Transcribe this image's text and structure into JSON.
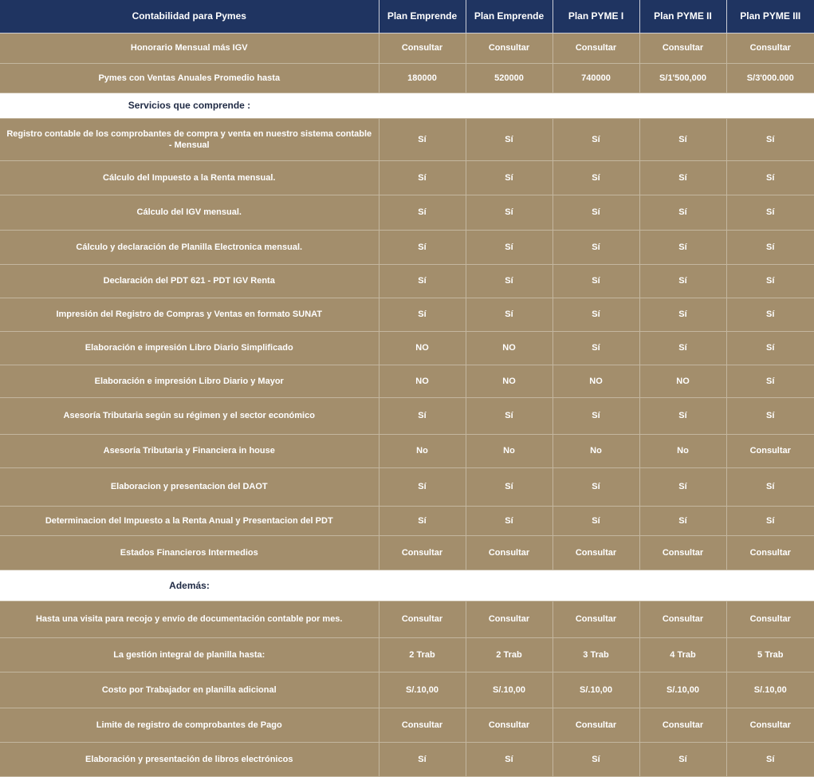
{
  "table": {
    "header": {
      "label": "Contabilidad para Pymes",
      "plans": [
        "Plan Emprende",
        "Plan Emprende",
        "Plan PYME I",
        "Plan PYME II",
        "Plan PYME III"
      ]
    },
    "colors": {
      "header_bg": "#1f3461",
      "row_bg": "#a38e6c",
      "section_bg": "#ffffff"
    },
    "sections": [
      {
        "title": "",
        "rows": [
          {
            "label": "Honorario Mensual más IGV",
            "values": [
              "Consultar",
              "Consultar",
              "Consultar",
              "Consultar",
              "Consultar"
            ]
          },
          {
            "label": "Pymes con Ventas Anuales Promedio hasta",
            "values": [
              "180000",
              "520000",
              "740000",
              "S/1'500,000",
              "S/3'000.000"
            ]
          }
        ]
      },
      {
        "title": "Servicios que comprende :",
        "rows": [
          {
            "label": "Registro contable de los comprobantes de compra y venta en nuestro sistema contable - Mensual",
            "values": [
              "Sí",
              "Sí",
              "Sí",
              "Sí",
              "Sí"
            ]
          },
          {
            "label": "Cálculo del Impuesto a la Renta mensual.",
            "values": [
              "Sí",
              "Sí",
              "Sí",
              "Sí",
              "Sí"
            ]
          },
          {
            "label": "Cálculo del IGV mensual.",
            "values": [
              "Sí",
              "Sí",
              "Sí",
              "Sí",
              "Sí"
            ]
          },
          {
            "label": "Cálculo y declaración de Planilla Electronica mensual.",
            "values": [
              "Sí",
              "Sí",
              "Sí",
              "Sí",
              "Sí"
            ]
          },
          {
            "label": "Declaración del PDT 621 - PDT IGV Renta",
            "values": [
              "Sí",
              "Sí",
              "Sí",
              "Sí",
              "Sí"
            ]
          },
          {
            "label": "Impresión del Registro de Compras y Ventas en formato SUNAT",
            "values": [
              "Sí",
              "Sí",
              "Sí",
              "Sí",
              "Sí"
            ]
          },
          {
            "label": "Elaboración e impresión Libro Diario Simplificado",
            "values": [
              "NO",
              "NO",
              "Sí",
              "Sí",
              "Sí"
            ]
          },
          {
            "label": "Elaboración e impresión Libro Diario y Mayor",
            "values": [
              "NO",
              "NO",
              "NO",
              "NO",
              "Sí"
            ]
          },
          {
            "label": "Asesoría Tributaria según su régimen y el sector económico",
            "values": [
              "Sí",
              "Sí",
              "Sí",
              "Sí",
              "Sí"
            ]
          },
          {
            "label": "Asesoría Tributaria y Financiera in house",
            "values": [
              "No",
              "No",
              "No",
              "No",
              "Consultar"
            ]
          },
          {
            "label": "Elaboracion y presentacion del DAOT",
            "values": [
              "Sí",
              "Sí",
              "Sí",
              "Sí",
              "Sí"
            ]
          },
          {
            "label": "Determinacion del Impuesto a la Renta Anual y Presentacion del PDT",
            "values": [
              "Sí",
              "Sí",
              "Sí",
              "Sí",
              "Sí"
            ]
          },
          {
            "label": "Estados Financieros Intermedios",
            "values": [
              "Consultar",
              "Consultar",
              "Consultar",
              "Consultar",
              "Consultar"
            ]
          }
        ]
      },
      {
        "title": "Además:",
        "rows": [
          {
            "label": "Hasta una visita para recojo y envío de documentación contable por mes.",
            "values": [
              "Consultar",
              "Consultar",
              "Consultar",
              "Consultar",
              "Consultar"
            ]
          },
          {
            "label": "La gestión integral de planilla hasta:",
            "values": [
              "2 Trab",
              "2 Trab",
              "3 Trab",
              "4 Trab",
              "5 Trab"
            ]
          },
          {
            "label": "Costo por Trabajador en planilla adicional",
            "values": [
              "S/.10,00",
              "S/.10,00",
              "S/.10,00",
              "S/.10,00",
              "S/.10,00"
            ]
          },
          {
            "label": "Limite de registro de comprobantes de Pago",
            "values": [
              "Consultar",
              "Consultar",
              "Consultar",
              "Consultar",
              "Consultar"
            ]
          },
          {
            "label": "Elaboración y presentación de libros electrónicos",
            "values": [
              "Sí",
              "Sí",
              "Sí",
              "Sí",
              "Sí"
            ]
          }
        ]
      }
    ]
  }
}
